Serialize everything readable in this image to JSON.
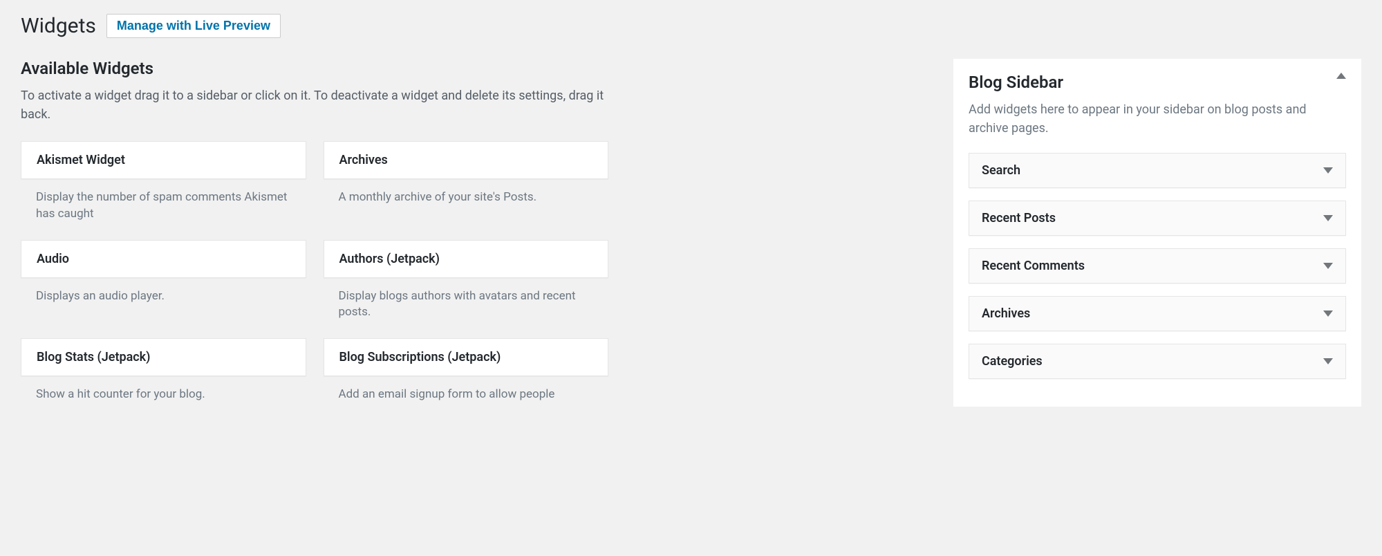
{
  "header": {
    "title": "Widgets",
    "manage_button": "Manage with Live Preview"
  },
  "available": {
    "heading": "Available Widgets",
    "description": "To activate a widget drag it to a sidebar or click on it. To deactivate a widget and delete its settings, drag it back.",
    "widgets": [
      {
        "title": "Akismet Widget",
        "desc": "Display the number of spam comments Akismet has caught"
      },
      {
        "title": "Archives",
        "desc": "A monthly archive of your site's Posts."
      },
      {
        "title": "Audio",
        "desc": "Displays an audio player."
      },
      {
        "title": "Authors (Jetpack)",
        "desc": "Display blogs authors with avatars and recent posts."
      },
      {
        "title": "Blog Stats (Jetpack)",
        "desc": "Show a hit counter for your blog."
      },
      {
        "title": "Blog Subscriptions (Jetpack)",
        "desc": "Add an email signup form to allow people"
      }
    ]
  },
  "sidebar": {
    "title": "Blog Sidebar",
    "description": "Add widgets here to appear in your sidebar on blog posts and archive pages.",
    "items": [
      {
        "title": "Search"
      },
      {
        "title": "Recent Posts"
      },
      {
        "title": "Recent Comments"
      },
      {
        "title": "Archives"
      },
      {
        "title": "Categories"
      }
    ]
  }
}
